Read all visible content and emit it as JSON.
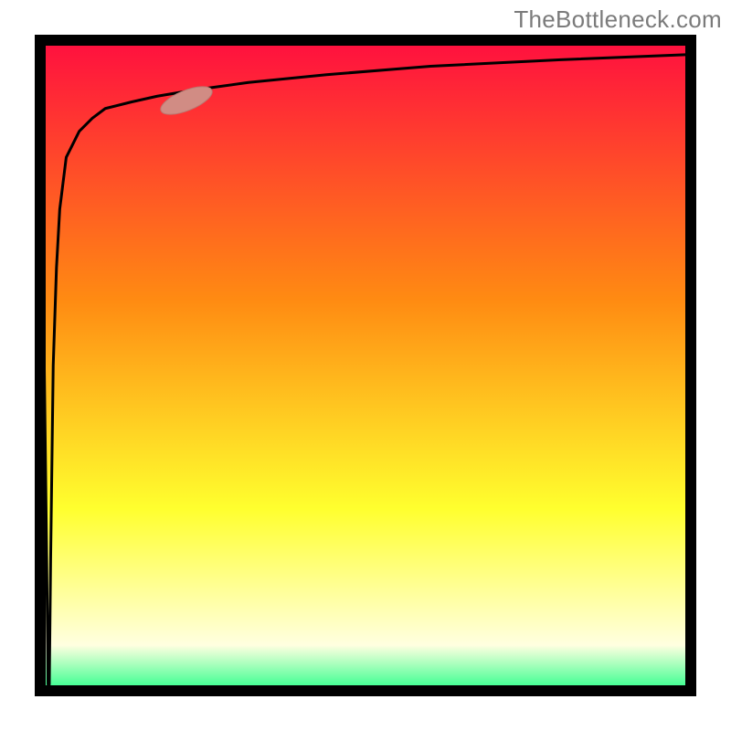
{
  "attribution": "TheBottleneck.com",
  "colors": {
    "frame": "#000000",
    "curve": "#000000",
    "marker_fill": "#d18c84",
    "marker_stroke": "#b87a72",
    "grad_top": "#ff0f3f",
    "grad_upper_mid": "#ff8b12",
    "grad_lower_mid": "#ffff2e",
    "grad_near_bottom": "#ffffe0",
    "grad_bottom": "#2eff8b"
  },
  "geometry": {
    "frame_x": 38,
    "frame_y": 38,
    "frame_w": 724,
    "frame_h": 724,
    "frame_stroke": 12,
    "curve_stroke": 3,
    "marker_cx": 204,
    "marker_cy": 110,
    "marker_rx": 30,
    "marker_ry": 11,
    "marker_rot": -22
  },
  "chart_data": {
    "type": "line",
    "title": "",
    "xlabel": "",
    "ylabel": "",
    "xlim": [
      0,
      100
    ],
    "ylim": [
      0,
      100
    ],
    "note": "Values are read from pixel positions relative to the plot frame; x,y are percentages of the visible axis range. The curve starts near zero at the left edge, drops almost immediately to the bottom (a near-vertical spike), then rises steeply to about 90% by x≈15 and asymptotes toward ~98% by the right edge. A single capsule-shaped marker sits on the curve near x≈22.",
    "series": [
      {
        "name": "curve",
        "x": [
          0.0,
          0.5,
          1.0,
          1.2,
          1.3,
          1.4,
          1.6,
          2.0,
          2.5,
          3.0,
          4.0,
          6.0,
          8.0,
          10.0,
          14.0,
          18.0,
          24.0,
          32.0,
          44.0,
          60.0,
          80.0,
          100.0
        ],
        "y": [
          98.0,
          60.0,
          20.0,
          1.0,
          0.5,
          1.0,
          20.0,
          50.0,
          65.0,
          74.0,
          82.0,
          86.0,
          88.0,
          89.5,
          90.5,
          91.4,
          92.4,
          93.5,
          94.7,
          96.0,
          97.0,
          97.8
        ]
      }
    ],
    "marker": {
      "x": 22.0,
      "y": 90.5
    },
    "background_gradient": {
      "orientation": "vertical",
      "stops": [
        {
          "pos": 0.0,
          "color": "#ff0f3f"
        },
        {
          "pos": 0.4,
          "color": "#ff8b12"
        },
        {
          "pos": 0.72,
          "color": "#ffff2e"
        },
        {
          "pos": 0.93,
          "color": "#ffffe0"
        },
        {
          "pos": 1.0,
          "color": "#2eff8b"
        }
      ]
    }
  }
}
